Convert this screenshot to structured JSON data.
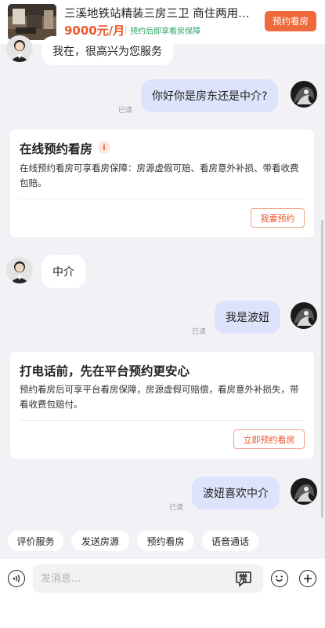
{
  "listing": {
    "title": "三溪地铁站精装三房三卫 商住两用…",
    "price": "9000元/月",
    "price_note": "预约后即享看房保障",
    "book_button": "预约看房"
  },
  "messages": {
    "agent_greeting": "我在，很高兴为您服务",
    "user_q1": "你好你是房东还是中介?",
    "user_q1_read": "已读",
    "agent_reply": "中介",
    "user_msg2": "我是波妞",
    "user_msg2_read": "已读",
    "user_msg3": "波妞喜欢中介",
    "user_msg3_read": "已读"
  },
  "cards": {
    "online": {
      "title": "在线预约看房",
      "info_icon": "i",
      "body": "在线预约看房可享看房保障：房源虚假可赔、看房意外补损、带看收费包赔。",
      "button": "我要预约"
    },
    "call": {
      "title": "打电话前，先在平台预约更安心",
      "body": "预约看房后可享平台看房保障，房源虚假可赔偿，看房意外补损失，带看收费包赔付。",
      "button": "立即预约看房"
    }
  },
  "quick_actions": [
    "评价服务",
    "发送房源",
    "预约看房",
    "语音通话"
  ],
  "input": {
    "placeholder": "发消息...",
    "phrase_label": "常"
  },
  "icons": {
    "voice": "voice-icon",
    "phrase": "common-phrase-icon",
    "emoji": "emoji-icon",
    "plus": "plus-icon"
  },
  "colors": {
    "accent": "#ef6a3b",
    "price": "#e8582f",
    "guarantee": "#31a36a",
    "user_bubble": "#dde3fb"
  }
}
